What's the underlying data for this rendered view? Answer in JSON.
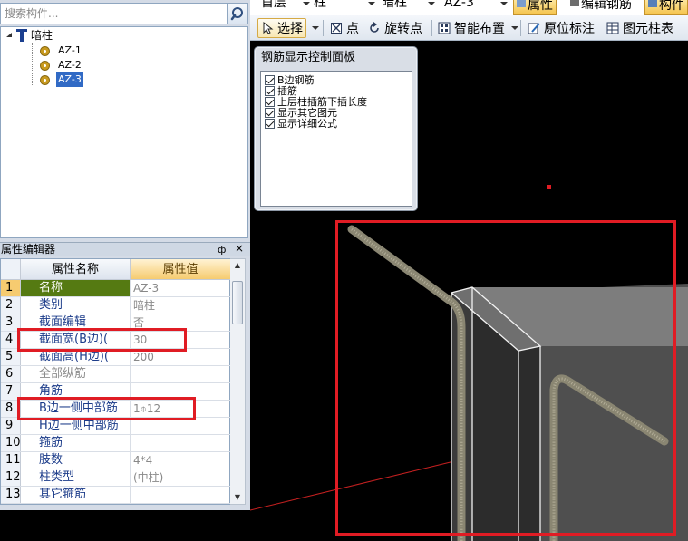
{
  "search": {
    "placeholder": "搜索构件..."
  },
  "tree": {
    "root": "暗柱",
    "items": [
      {
        "label": "AZ-1",
        "selected": false
      },
      {
        "label": "AZ-2",
        "selected": false
      },
      {
        "label": "AZ-3",
        "selected": true
      }
    ]
  },
  "properties_panel": {
    "title": "属性编辑器",
    "pin": "ф",
    "close": "×",
    "header_name": "属性名称",
    "header_value": "属性值",
    "rows": [
      {
        "num": "1",
        "name": "名称",
        "value": "AZ-3"
      },
      {
        "num": "2",
        "name": "类别",
        "value": "暗柱"
      },
      {
        "num": "3",
        "name": "截面编辑",
        "value": "否"
      },
      {
        "num": "4",
        "name": "截面宽(B边)(",
        "value": "30"
      },
      {
        "num": "5",
        "name": "截面高(H边)(",
        "value": "200"
      },
      {
        "num": "6",
        "name": "全部纵筋",
        "value": ""
      },
      {
        "num": "7",
        "name": "角筋",
        "value": ""
      },
      {
        "num": "8",
        "name": "B边一侧中部筋",
        "value": "1⌽12"
      },
      {
        "num": "9",
        "name": "H边一侧中部筋",
        "value": ""
      },
      {
        "num": "10",
        "name": "箍筋",
        "value": ""
      },
      {
        "num": "11",
        "name": "肢数",
        "value": "4*4"
      },
      {
        "num": "12",
        "name": "柱类型",
        "value": "(中柱)"
      },
      {
        "num": "13",
        "name": "其它箍筋",
        "value": ""
      }
    ]
  },
  "toolbar_top": {
    "floor": "首层",
    "type": "柱",
    "subtype": "暗柱",
    "member": "AZ-3",
    "properties": "属性",
    "edit_rebar": "编辑钢筋",
    "member_list": "构件"
  },
  "toolbar": {
    "select": "选择",
    "point": "点",
    "rotate_point": "旋转点",
    "smart_layout": "智能布置",
    "in_situ_label": "原位标注",
    "element_column_table": "图元柱表"
  },
  "rebar_panel": {
    "title": "钢筋显示控制面板",
    "options": [
      {
        "label": "B边钢筋",
        "checked": true
      },
      {
        "label": "插筋",
        "checked": true
      },
      {
        "label": "上层柱插筋下插长度",
        "checked": true
      },
      {
        "label": "显示其它图元",
        "checked": true
      },
      {
        "label": "显示详细公式",
        "checked": true
      }
    ]
  },
  "colors": {
    "highlight": "#e01c24",
    "selected_row": "#557a12",
    "value_header": "#f6cb70",
    "tree_selection": "#316ac5",
    "rebar": "#8a8672"
  },
  "icons": {
    "search": "search-icon",
    "tree_root": "column-type-icon",
    "tree_item": "gear-icon",
    "select": "cursor-icon",
    "point": "point-icon",
    "rotate_point": "rotate-icon",
    "smart_layout": "smart-layout-icon",
    "in_situ_label": "pencil-icon",
    "element_column_table": "table-icon"
  }
}
